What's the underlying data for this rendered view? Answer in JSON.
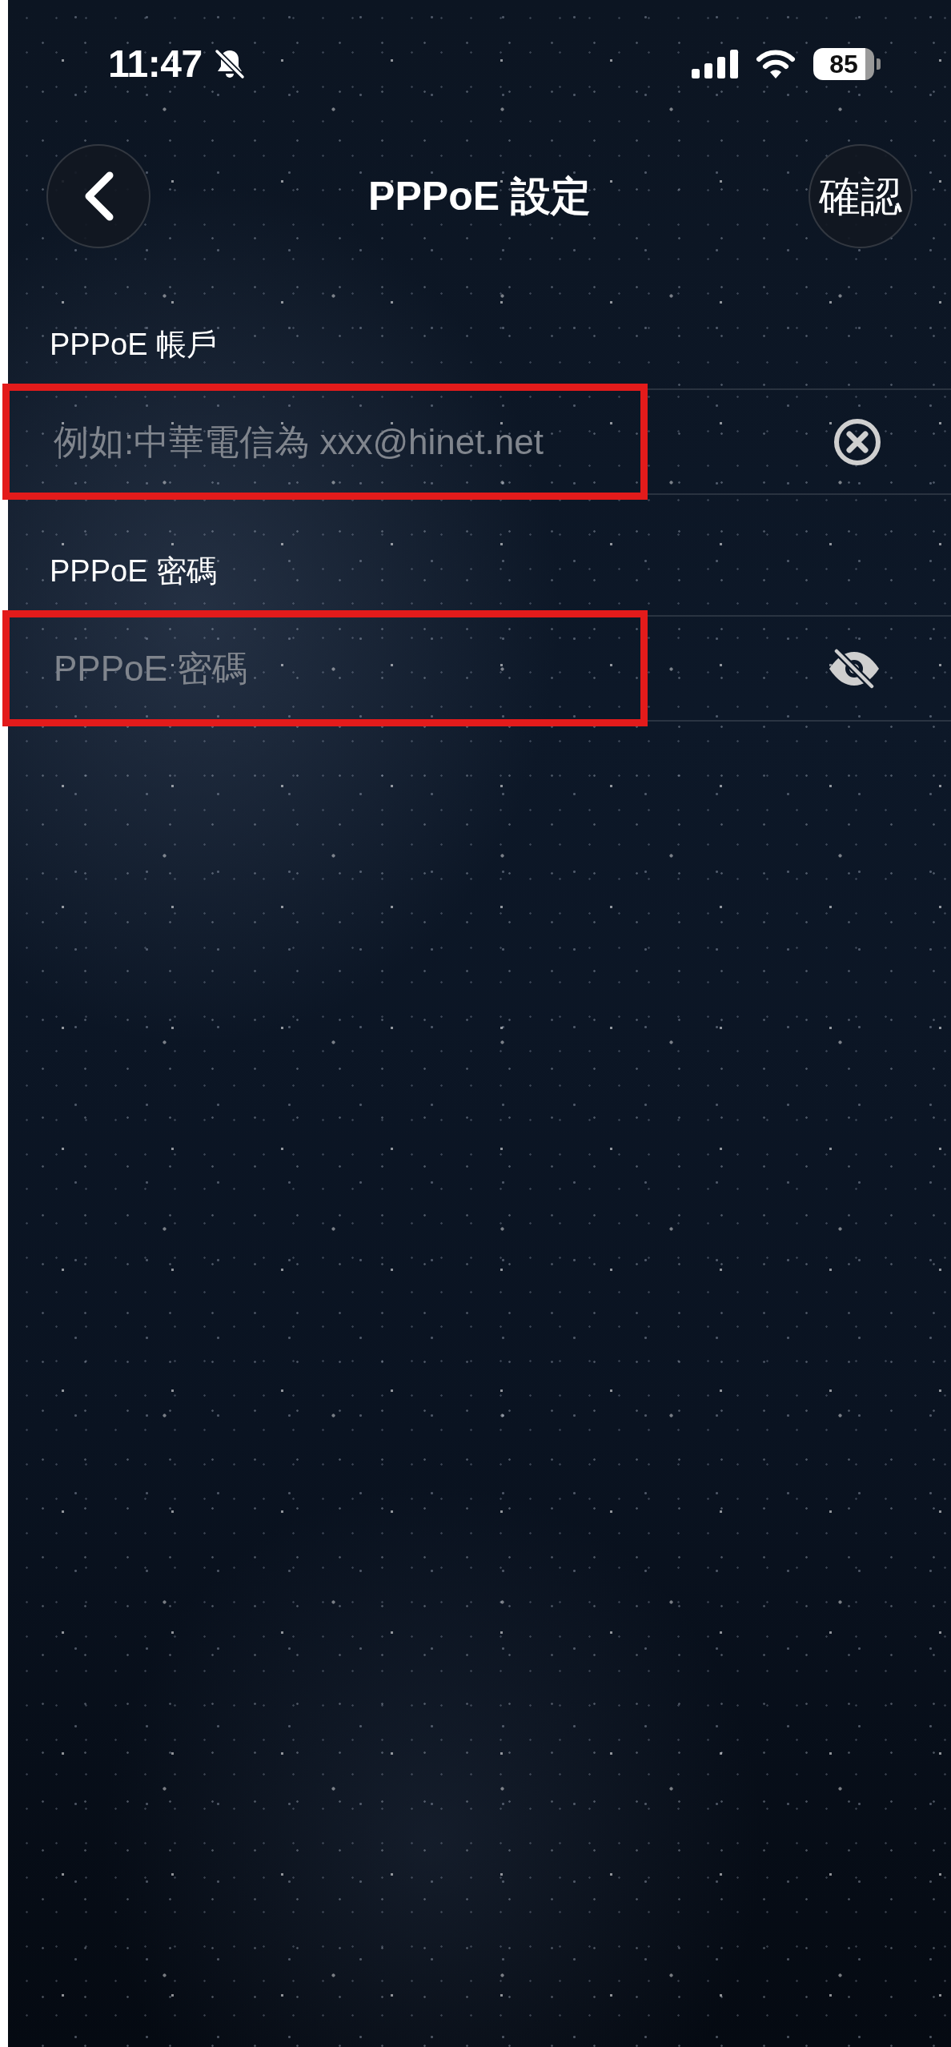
{
  "status_bar": {
    "time": "11:47",
    "silent": true,
    "battery": "85"
  },
  "header": {
    "title": "PPPoE 設定",
    "confirm": "確認"
  },
  "fields": [
    {
      "label": "PPPoE 帳戶",
      "placeholder": "例如:中華電信為 xxx@hinet.net",
      "kind": "clearable",
      "highlighted": true
    },
    {
      "label": "PPPoE 密碼",
      "placeholder": "PPPoE 密碼",
      "kind": "password",
      "revealed": false,
      "highlighted": true
    }
  ]
}
